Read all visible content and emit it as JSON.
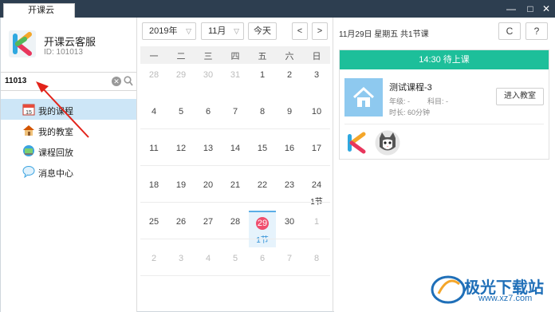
{
  "window": {
    "tab_label": "开课云",
    "minimize": "—",
    "maximize": "□",
    "close": "✕"
  },
  "profile": {
    "name": "开课云客服",
    "id": "ID: 101013"
  },
  "search": {
    "value": "11013"
  },
  "nav": {
    "items": [
      {
        "label": "我的课程",
        "icon": "calendar-icon",
        "active": true
      },
      {
        "label": "我的教室",
        "icon": "house-icon",
        "active": false
      },
      {
        "label": "课程回放",
        "icon": "replay-icon",
        "active": false
      },
      {
        "label": "消息中心",
        "icon": "message-icon",
        "active": false
      }
    ]
  },
  "calendar": {
    "year": "2019年",
    "month": "11月",
    "today_btn": "今天",
    "prev": "<",
    "next": ">",
    "weekdays": [
      "一",
      "二",
      "三",
      "四",
      "五",
      "六",
      "日"
    ],
    "weeks": [
      [
        {
          "d": "28",
          "o": true
        },
        {
          "d": "29",
          "o": true
        },
        {
          "d": "30",
          "o": true
        },
        {
          "d": "31",
          "o": true
        },
        {
          "d": "1"
        },
        {
          "d": "2"
        },
        {
          "d": "3"
        }
      ],
      [
        {
          "d": "4"
        },
        {
          "d": "5"
        },
        {
          "d": "6"
        },
        {
          "d": "7"
        },
        {
          "d": "8"
        },
        {
          "d": "9"
        },
        {
          "d": "10"
        }
      ],
      [
        {
          "d": "11"
        },
        {
          "d": "12"
        },
        {
          "d": "13"
        },
        {
          "d": "14"
        },
        {
          "d": "15"
        },
        {
          "d": "16"
        },
        {
          "d": "17"
        }
      ],
      [
        {
          "d": "18"
        },
        {
          "d": "19"
        },
        {
          "d": "20"
        },
        {
          "d": "21"
        },
        {
          "d": "22"
        },
        {
          "d": "23"
        },
        {
          "d": "24",
          "c": "1节"
        }
      ],
      [
        {
          "d": "25"
        },
        {
          "d": "26"
        },
        {
          "d": "27"
        },
        {
          "d": "28"
        },
        {
          "d": "29",
          "c": "1节",
          "t": true
        },
        {
          "d": "30"
        },
        {
          "d": "1",
          "o": true
        }
      ],
      [
        {
          "d": "2",
          "o": true
        },
        {
          "d": "3",
          "o": true
        },
        {
          "d": "4",
          "o": true
        },
        {
          "d": "5",
          "o": true
        },
        {
          "d": "6",
          "o": true
        },
        {
          "d": "7",
          "o": true
        },
        {
          "d": "8",
          "o": true
        }
      ]
    ]
  },
  "schedule": {
    "header": "11月29日 星期五 共1节课",
    "refresh": "C",
    "help": "?",
    "status": "14:30  待上课",
    "course_title": "测试课程-3",
    "grade": "年级: -",
    "subject": "科目: -",
    "duration": "时长: 60分钟",
    "enter_btn": "进入教室"
  },
  "watermark": {
    "text": "极光下载站",
    "url": "www.xz7.com"
  }
}
